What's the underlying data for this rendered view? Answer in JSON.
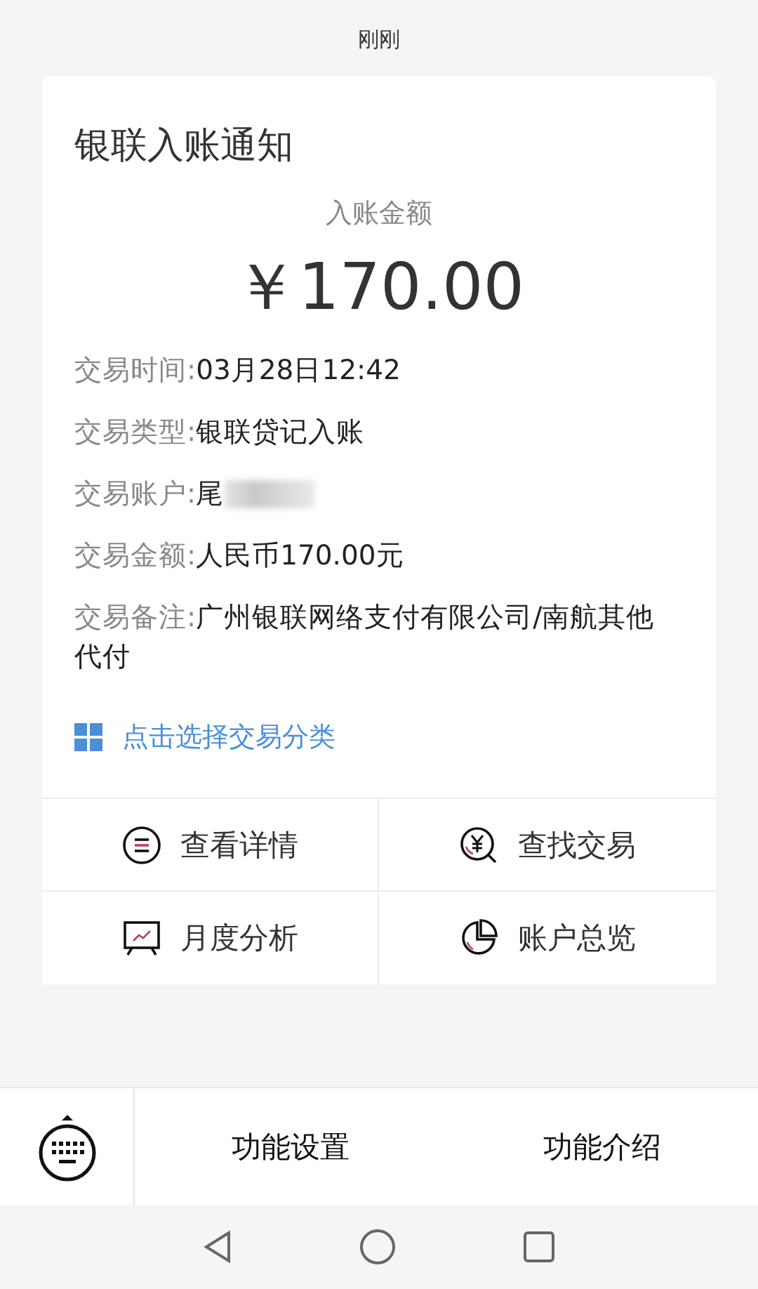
{
  "status_text": "刚刚",
  "card": {
    "title": "银联入账通知",
    "amount_label": "入账金额",
    "amount": "￥170.00",
    "details": [
      {
        "label": "交易时间:",
        "value": "03月28日12:42",
        "redacted": false
      },
      {
        "label": "交易类型:",
        "value": "银联贷记入账",
        "redacted": false
      },
      {
        "label": "交易账户:",
        "value": "尾",
        "redacted": true
      },
      {
        "label": "交易金额:",
        "value": "人民币170.00元",
        "redacted": false
      },
      {
        "label": "交易备注:",
        "value": "广州银联网络支付有限公司/南航其他代付",
        "redacted": false
      }
    ],
    "category_link": "点击选择交易分类",
    "actions": [
      {
        "kind": "details",
        "label": "查看详情"
      },
      {
        "kind": "search",
        "label": "查找交易"
      },
      {
        "kind": "chart",
        "label": "月度分析"
      },
      {
        "kind": "pie",
        "label": "账户总览"
      }
    ]
  },
  "bottom_menu": [
    {
      "label": "功能设置"
    },
    {
      "label": "功能介绍"
    }
  ]
}
